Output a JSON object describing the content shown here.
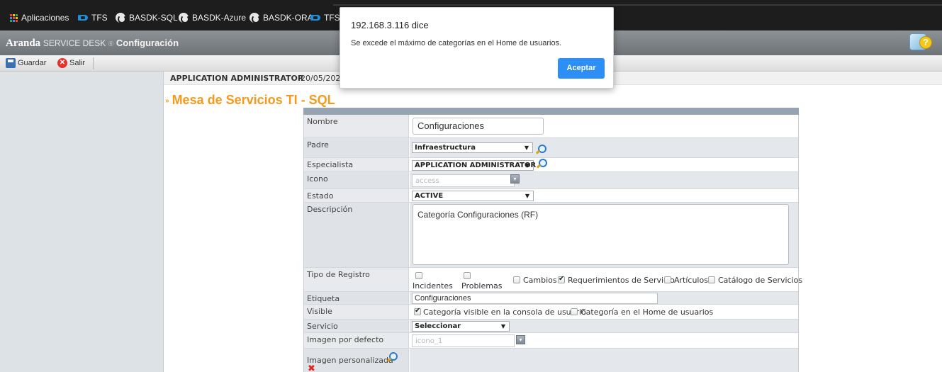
{
  "bookmarks": [
    {
      "label": "Aplicaciones",
      "icon": "apps-grid-icon"
    },
    {
      "label": "TFS",
      "icon": "visual-studio-icon"
    },
    {
      "label": "BASDK-SQL",
      "icon": "globe-icon"
    },
    {
      "label": "BASDK-Azure",
      "icon": "globe-icon"
    },
    {
      "label": "BASDK-ORA",
      "icon": "globe-icon"
    },
    {
      "label": "TFS",
      "icon": "visual-studio-icon"
    }
  ],
  "header": {
    "brand": "Aranda",
    "product": "SERVICE DESK",
    "separator": "®",
    "section": "Configuración"
  },
  "toolbar": {
    "save_label": "Guardar",
    "exit_label": "Salir"
  },
  "user_bar": {
    "user": "APPLICATION ADMINISTRATOR",
    "date": "20/05/2020"
  },
  "page": {
    "title": "Mesa de Servicios TI - SQL"
  },
  "form": {
    "nombre": {
      "label": "Nombre",
      "value": "Configuraciones"
    },
    "padre": {
      "label": "Padre",
      "value": "Infraestructura"
    },
    "especialista": {
      "label": "Especialista",
      "value": "APPLICATION ADMINISTRATOR"
    },
    "icono": {
      "label": "Icono",
      "placeholder": "access"
    },
    "estado": {
      "label": "Estado",
      "value": "ACTIVE"
    },
    "descripcion": {
      "label": "Descripción",
      "value": "Categoría Configuraciones (RF)"
    },
    "tipo_registro": {
      "label": "Tipo de Registro",
      "options": [
        {
          "label": "Incidentes",
          "checked": false
        },
        {
          "label": "Problemas",
          "checked": false
        },
        {
          "label": "Cambios",
          "checked": false
        },
        {
          "label": "Requerimientos de Servicio",
          "checked": true
        },
        {
          "label": "Artículos",
          "checked": false
        },
        {
          "label": "Catálogo de Servicios",
          "checked": false
        }
      ]
    },
    "etiqueta": {
      "label": "Etiqueta",
      "value": "Configuraciones"
    },
    "visible": {
      "label": "Visible",
      "options": [
        {
          "label": "Categoría visible en la consola de usuario",
          "checked": true
        },
        {
          "label": "Categoría en el Home de usuarios",
          "checked": false
        }
      ]
    },
    "servicio": {
      "label": "Servicio",
      "value": "Seleccionar"
    },
    "imagen_defecto": {
      "label": "Imagen por defecto",
      "placeholder": "icono_1"
    },
    "imagen_personalizada": {
      "label": "Imagen personalizada"
    }
  },
  "dialog": {
    "title": "192.168.3.116 dice",
    "message": "Se excede el máximo de categorías en el Home de usuarios.",
    "button": "Aceptar"
  },
  "colors": {
    "title_orange": "#f39a1e",
    "dialog_button": "#2d8ef5",
    "header_gray": "#7e8388"
  }
}
